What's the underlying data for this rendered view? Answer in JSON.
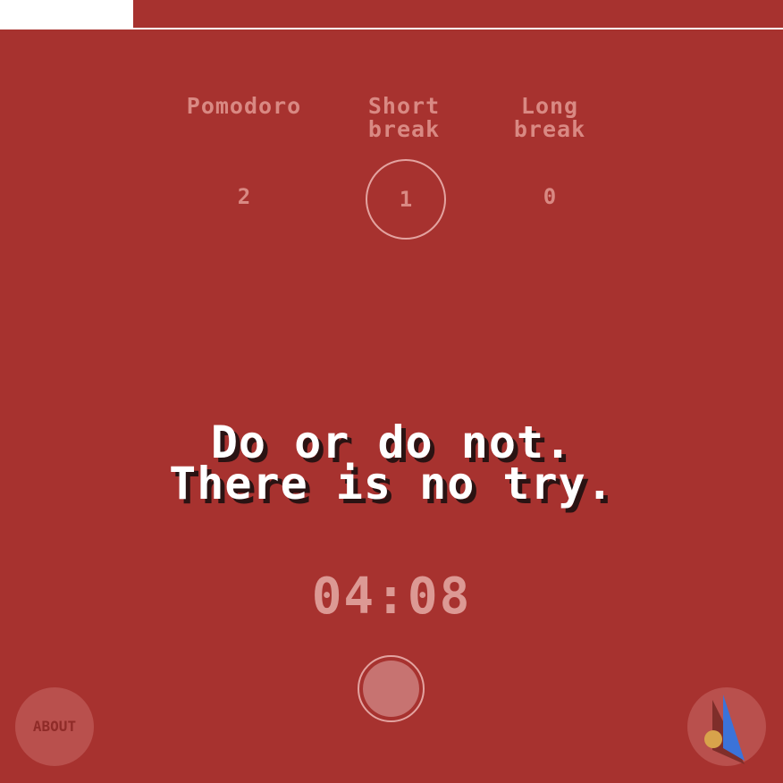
{
  "progress": {
    "fraction": 0.17,
    "track_color": "#a7322f",
    "fill_color": "#ffffff"
  },
  "modes": [
    {
      "label": "Pomodoro",
      "count": "2",
      "active": false
    },
    {
      "label": "Short\nbreak",
      "count": "1",
      "active": true
    },
    {
      "label": "Long\nbreak",
      "count": "0",
      "active": false
    }
  ],
  "quote": "Do or do not.\nThere is no try.",
  "timer": "04:08",
  "controls": {
    "start_icon": "circle-button-icon",
    "about_label": "ABOUT",
    "logo_icon": "compass-logo-icon"
  },
  "colors": {
    "background": "#a7322f",
    "text_muted": "#d98983",
    "quote_text": "#ffffff",
    "logo_blue": "#3b73d9",
    "logo_gold": "#d8a34b"
  }
}
